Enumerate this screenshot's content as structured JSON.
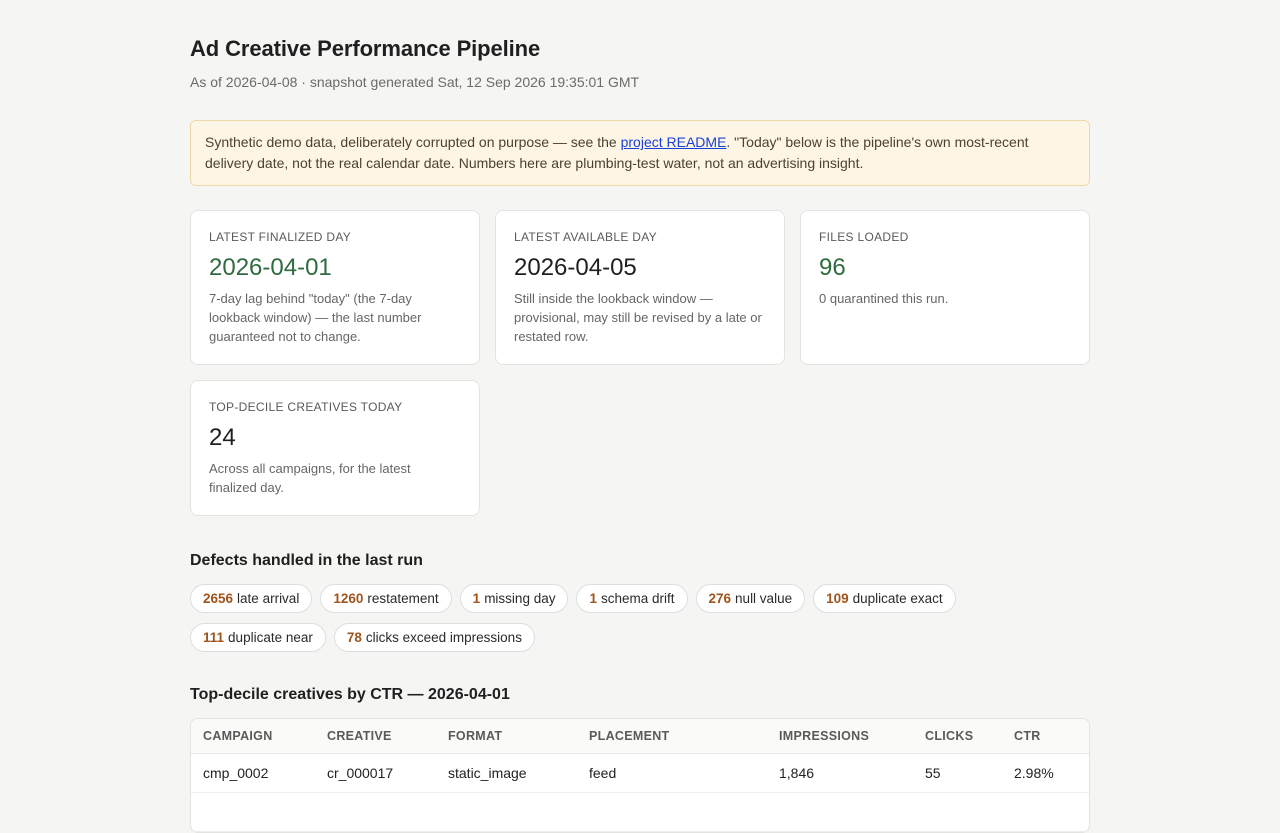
{
  "header": {
    "title": "Ad Creative Performance Pipeline",
    "subtitle": "As of 2026-04-08 · snapshot generated Sat, 12 Sep 2026 19:35:01 GMT"
  },
  "notice": {
    "text_before": "Synthetic demo data, deliberately corrupted on purpose — see the ",
    "link_text": "project README",
    "text_after": ". \"Today\" below is the pipeline's own most-recent delivery date, not the real calendar date. Numbers here are plumbing-test water, not an advertising insight."
  },
  "cards": [
    {
      "label": "Latest finalized day",
      "value": "2026-04-01",
      "desc": "7-day lag behind \"today\" (the 7-day lookback window) — the last number guaranteed not to change."
    },
    {
      "label": "Latest available day",
      "value": "2026-04-05",
      "desc": "Still inside the lookback window — provisional, may still be revised by a late or restated row."
    },
    {
      "label": "Files loaded",
      "value": "96",
      "desc": "0 quarantined this run."
    },
    {
      "label": "Top-decile creatives today",
      "value": "24",
      "desc": "Across all campaigns, for the latest finalized day."
    }
  ],
  "defects": {
    "title": "Defects handled in the last run",
    "items": [
      {
        "count": "2656",
        "label": "late arrival"
      },
      {
        "count": "1260",
        "label": "restatement"
      },
      {
        "count": "1",
        "label": "missing day"
      },
      {
        "count": "1",
        "label": "schema drift"
      },
      {
        "count": "276",
        "label": "null value"
      },
      {
        "count": "109",
        "label": "duplicate exact"
      },
      {
        "count": "111",
        "label": "duplicate near"
      },
      {
        "count": "78",
        "label": "clicks exceed impressions"
      }
    ]
  },
  "top_table": {
    "title": "Top-decile creatives by CTR — 2026-04-01",
    "columns": [
      "Campaign",
      "Creative",
      "Format",
      "Placement",
      "Impressions",
      "Clicks",
      "CTR"
    ],
    "rows": [
      [
        "cmp_0002",
        "cr_000017",
        "static_image",
        "feed",
        "1,846",
        "55",
        "2.98%"
      ]
    ]
  },
  "colors": {
    "accent_green": "#2f6b3f",
    "defect_count": "#a0541c",
    "notice_bg": "#fdf6e6"
  }
}
